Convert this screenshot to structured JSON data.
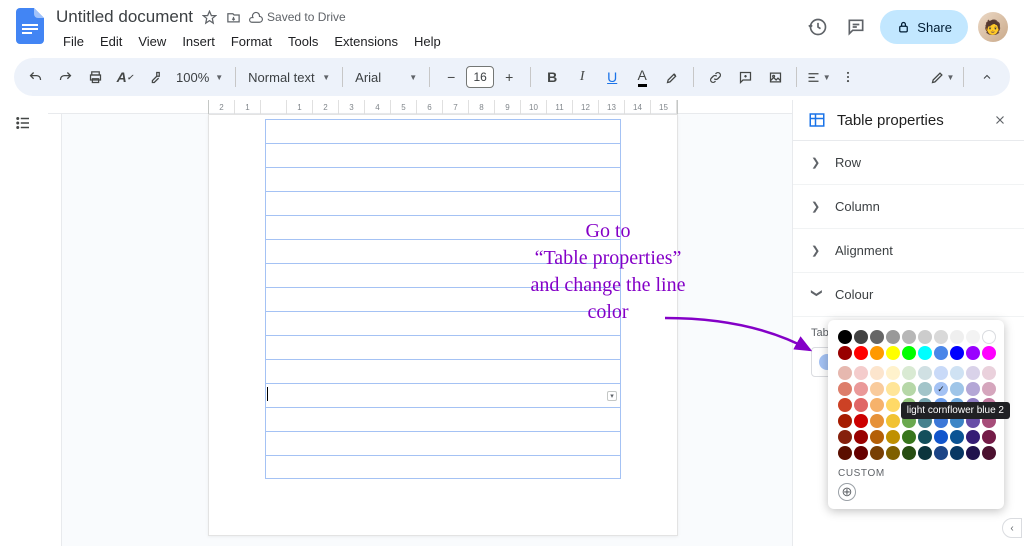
{
  "doc": {
    "title": "Untitled document",
    "save_status": "Saved to Drive"
  },
  "menus": [
    "File",
    "Edit",
    "View",
    "Insert",
    "Format",
    "Tools",
    "Extensions",
    "Help"
  ],
  "toolbar": {
    "zoom": "100%",
    "style": "Normal text",
    "font": "Arial",
    "font_size": "16"
  },
  "share_label": "Share",
  "sidebar": {
    "title": "Table properties",
    "sections": {
      "row": "Row",
      "column": "Column",
      "alignment": "Alignment",
      "colour": "Colour"
    },
    "table_border_label": "Table border"
  },
  "palette": {
    "custom_label": "CUSTOM",
    "tooltip": "light cornflower blue 2",
    "selected_color": "#a4c2f4",
    "standard_rows": [
      [
        "#000000",
        "#434343",
        "#666666",
        "#999999",
        "#b7b7b7",
        "#cccccc",
        "#d9d9d9",
        "#efefef",
        "#f3f3f3",
        "#ffffff"
      ],
      [
        "#980000",
        "#ff0000",
        "#ff9900",
        "#ffff00",
        "#00ff00",
        "#00ffff",
        "#4a86e8",
        "#0000ff",
        "#9900ff",
        "#ff00ff"
      ]
    ],
    "tint_rows": [
      [
        "#e6b8af",
        "#f4cccc",
        "#fce5cd",
        "#fff2cc",
        "#d9ead3",
        "#d0e0e3",
        "#c9daf8",
        "#cfe2f3",
        "#d9d2e9",
        "#ead1dc"
      ],
      [
        "#dd7e6b",
        "#ea9999",
        "#f9cb9c",
        "#ffe599",
        "#b6d7a8",
        "#a2c4c9",
        "#a4c2f4",
        "#9fc5e8",
        "#b4a7d6",
        "#d5a6bd"
      ],
      [
        "#cc4125",
        "#e06666",
        "#f6b26b",
        "#ffd966",
        "#93c47d",
        "#76a5af",
        "#6d9eeb",
        "#6fa8dc",
        "#8e7cc3",
        "#c27ba0"
      ],
      [
        "#a61c00",
        "#cc0000",
        "#e69138",
        "#f1c232",
        "#6aa84f",
        "#45818e",
        "#3c78d8",
        "#3d85c6",
        "#674ea7",
        "#a64d79"
      ],
      [
        "#85200c",
        "#990000",
        "#b45f06",
        "#bf9000",
        "#38761d",
        "#134f5c",
        "#1155cc",
        "#0b5394",
        "#351c75",
        "#741b47"
      ],
      [
        "#5b0f00",
        "#660000",
        "#783f04",
        "#7f6000",
        "#274e13",
        "#0c343d",
        "#1c4587",
        "#073763",
        "#20124d",
        "#4c1130"
      ]
    ]
  },
  "ruler_ticks": [
    "2",
    "1",
    "",
    "1",
    "2",
    "3",
    "4",
    "5",
    "6",
    "7",
    "8",
    "9",
    "10",
    "11",
    "12",
    "13",
    "14",
    "15"
  ],
  "annotation": {
    "line1": "Go to",
    "line2": "“Table properties”",
    "line3": "and change the line",
    "line4": "color"
  }
}
